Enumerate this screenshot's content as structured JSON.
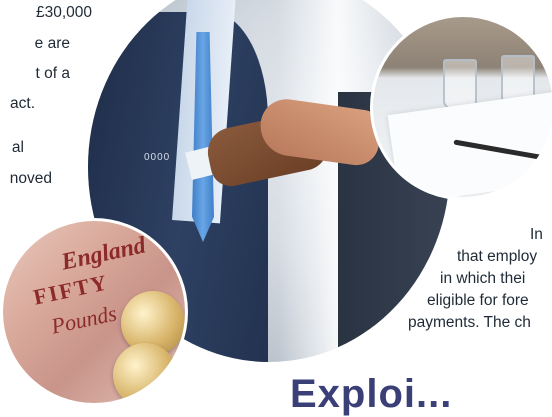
{
  "left_text": {
    "lines": [
      "£30,000",
      "e are",
      "t of a",
      "act.",
      "al",
      "noved"
    ]
  },
  "right_text": {
    "lines": [
      "In",
      "that employ",
      "in which thei",
      "eligible for fore",
      "payments. The ch"
    ]
  },
  "heading": {
    "text": "Exploi..."
  },
  "images": {
    "handshake": "handshake-photo",
    "meeting_table": "meeting-table-photo",
    "banknote": "banknote-coins-photo"
  },
  "banknote_marks": {
    "england": "England",
    "fifty": "FIFTY",
    "pounds": "Pounds"
  },
  "handshake_marks": {
    "buttons": "0000"
  },
  "colors": {
    "heading": "#3a3f78",
    "body_text": "#1f2a36"
  }
}
